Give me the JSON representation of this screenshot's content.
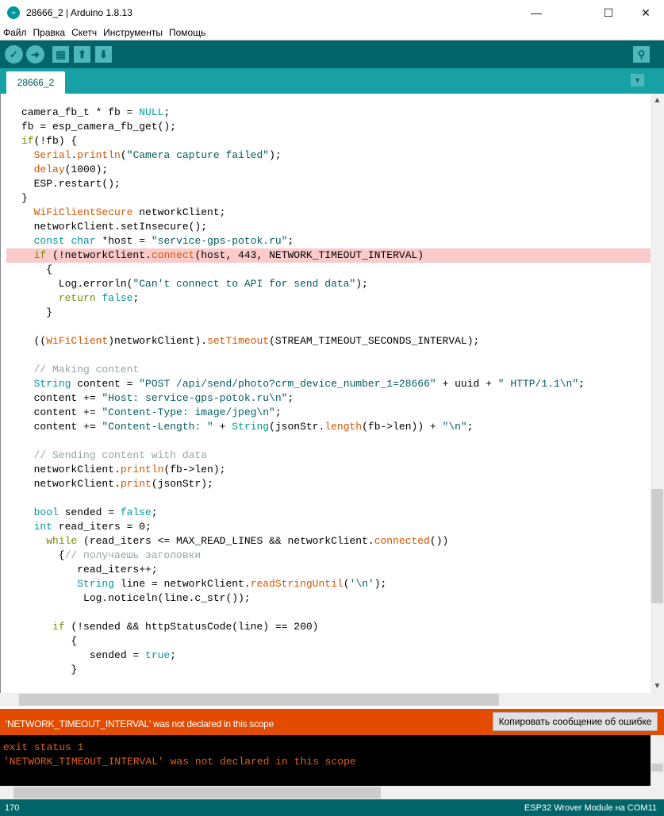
{
  "window": {
    "title": "28666_2 | Arduino 1.8.13",
    "minimize": "—",
    "maximize": "☐",
    "close": "✕",
    "app_icon": "∞"
  },
  "menu": [
    "Файл",
    "Правка",
    "Скетч",
    "Инструменты",
    "Помощь"
  ],
  "toolbar": {
    "verify": "✓",
    "upload": "➜",
    "new": "▤",
    "open": "⬆",
    "save": "⬇",
    "serial_monitor": "⚲"
  },
  "tab": {
    "label": "28666_2",
    "menu_icon": "▼"
  },
  "code": [
    [
      [
        "camera_fb_t * fb = ",
        ""
      ],
      [
        "NULL",
        "t"
      ],
      [
        ";",
        ""
      ]
    ],
    [
      [
        "fb = esp_camera_fb_get();",
        ""
      ]
    ],
    [
      [
        "if",
        "c"
      ],
      [
        "(!fb) {",
        ""
      ]
    ],
    [
      [
        "  ",
        ""
      ],
      [
        "Serial",
        "k"
      ],
      [
        ".",
        ""
      ],
      [
        "println",
        "k"
      ],
      [
        "(",
        ""
      ],
      [
        "\"Camera capture failed\"",
        "s"
      ],
      [
        ");",
        ""
      ]
    ],
    [
      [
        "  ",
        ""
      ],
      [
        "delay",
        "k"
      ],
      [
        "(1000);",
        ""
      ]
    ],
    [
      [
        "  ESP.restart();",
        ""
      ]
    ],
    [
      [
        "}",
        ""
      ]
    ],
    [
      [
        "  ",
        ""
      ],
      [
        "WiFiClientSecure",
        "k"
      ],
      [
        " networkClient;",
        ""
      ]
    ],
    [
      [
        "  networkClient.setInsecure();",
        ""
      ]
    ],
    [
      [
        "  ",
        ""
      ],
      [
        "const",
        "t"
      ],
      [
        " ",
        ""
      ],
      [
        "char",
        "t"
      ],
      [
        " *host = ",
        ""
      ],
      [
        "\"service-gps-potok.ru\"",
        "s"
      ],
      [
        ";",
        ""
      ]
    ],
    [
      [
        "  ",
        ""
      ],
      [
        "if",
        "c"
      ],
      [
        " (!networkClient.",
        ""
      ],
      [
        "connect",
        "k"
      ],
      [
        "(host, 443, NETWORK_TIMEOUT_INTERVAL)",
        ""
      ]
    ],
    [
      [
        "    {",
        ""
      ]
    ],
    [
      [
        "      Log.errorln(",
        ""
      ],
      [
        "\"Can't connect to API for send data\"",
        "s"
      ],
      [
        ");",
        ""
      ]
    ],
    [
      [
        "      ",
        ""
      ],
      [
        "return",
        "c"
      ],
      [
        " ",
        ""
      ],
      [
        "false",
        "t"
      ],
      [
        ";",
        ""
      ]
    ],
    [
      [
        "    }",
        ""
      ]
    ],
    [],
    [
      [
        "  ((",
        ""
      ],
      [
        "WiFiClient",
        "k"
      ],
      [
        ")networkClient).",
        ""
      ],
      [
        "setTimeout",
        "k"
      ],
      [
        "(STREAM_TIMEOUT_SECONDS_INTERVAL);",
        ""
      ]
    ],
    [],
    [
      [
        "  // Making content",
        "m"
      ]
    ],
    [
      [
        "  ",
        ""
      ],
      [
        "String",
        "t"
      ],
      [
        " content = ",
        ""
      ],
      [
        "\"POST /api/send/photo?crm_device_number_1=28666\"",
        "s"
      ],
      [
        " + uuid + ",
        ""
      ],
      [
        "\" HTTP/1.1\\n\"",
        "s"
      ],
      [
        ";",
        ""
      ]
    ],
    [
      [
        "  content += ",
        ""
      ],
      [
        "\"Host: service-gps-potok.ru\\n\"",
        "s"
      ],
      [
        ";",
        ""
      ]
    ],
    [
      [
        "  content += ",
        ""
      ],
      [
        "\"Content-Type: image/jpeg\\n\"",
        "s"
      ],
      [
        ";",
        ""
      ]
    ],
    [
      [
        "  content += ",
        ""
      ],
      [
        "\"Content-Length: \"",
        "s"
      ],
      [
        " + ",
        ""
      ],
      [
        "String",
        "t"
      ],
      [
        "(jsonStr.",
        ""
      ],
      [
        "length",
        "k"
      ],
      [
        "(fb->len)) + ",
        ""
      ],
      [
        "\"\\n\"",
        "s"
      ],
      [
        ";",
        ""
      ]
    ],
    [],
    [
      [
        "  // Sending content with data",
        "m"
      ]
    ],
    [
      [
        "  networkClient.",
        ""
      ],
      [
        "println",
        "k"
      ],
      [
        "(fb->len);",
        ""
      ]
    ],
    [
      [
        "  networkClient.",
        ""
      ],
      [
        "print",
        "k"
      ],
      [
        "(jsonStr);",
        ""
      ]
    ],
    [],
    [
      [
        "  ",
        ""
      ],
      [
        "bool",
        "t"
      ],
      [
        " sended = ",
        ""
      ],
      [
        "false",
        "t"
      ],
      [
        ";",
        ""
      ]
    ],
    [
      [
        "  ",
        ""
      ],
      [
        "int",
        "t"
      ],
      [
        " read_iters = 0;",
        ""
      ]
    ],
    [
      [
        "    ",
        ""
      ],
      [
        "while",
        "c"
      ],
      [
        " (read_iters <= MAX_READ_LINES && networkClient.",
        ""
      ],
      [
        "connected",
        "k"
      ],
      [
        "())",
        ""
      ]
    ],
    [
      [
        "      {",
        ""
      ],
      [
        "// получаешь заголовки",
        "m"
      ]
    ],
    [
      [
        "         read_iters++;",
        ""
      ]
    ],
    [
      [
        "         ",
        ""
      ],
      [
        "String",
        "t"
      ],
      [
        " line = networkClient.",
        ""
      ],
      [
        "readStringUntil",
        "k"
      ],
      [
        "(",
        ""
      ],
      [
        "'\\n'",
        "s"
      ],
      [
        ");",
        ""
      ]
    ],
    [
      [
        "          Log.noticeln(line.c_str());",
        ""
      ]
    ],
    [],
    [
      [
        "     ",
        ""
      ],
      [
        "if",
        "c"
      ],
      [
        " (!sended && httpStatusCode(line) == 200)",
        ""
      ]
    ],
    [
      [
        "        {",
        ""
      ]
    ],
    [
      [
        "           sended = ",
        ""
      ],
      [
        "true",
        "t"
      ],
      [
        ";",
        ""
      ]
    ],
    [
      [
        "        }",
        ""
      ]
    ]
  ],
  "error": {
    "message": "'NETWORK_TIMEOUT_INTERVAL' was not declared in this scope",
    "copy_button": "Копировать сообщение об ошибке"
  },
  "console": {
    "lines": [
      "exit status 1",
      "'NETWORK_TIMEOUT_INTERVAL' was not declared in this scope"
    ]
  },
  "status": {
    "line": "170",
    "board": "ESP32 Wrover Module на COM11"
  }
}
